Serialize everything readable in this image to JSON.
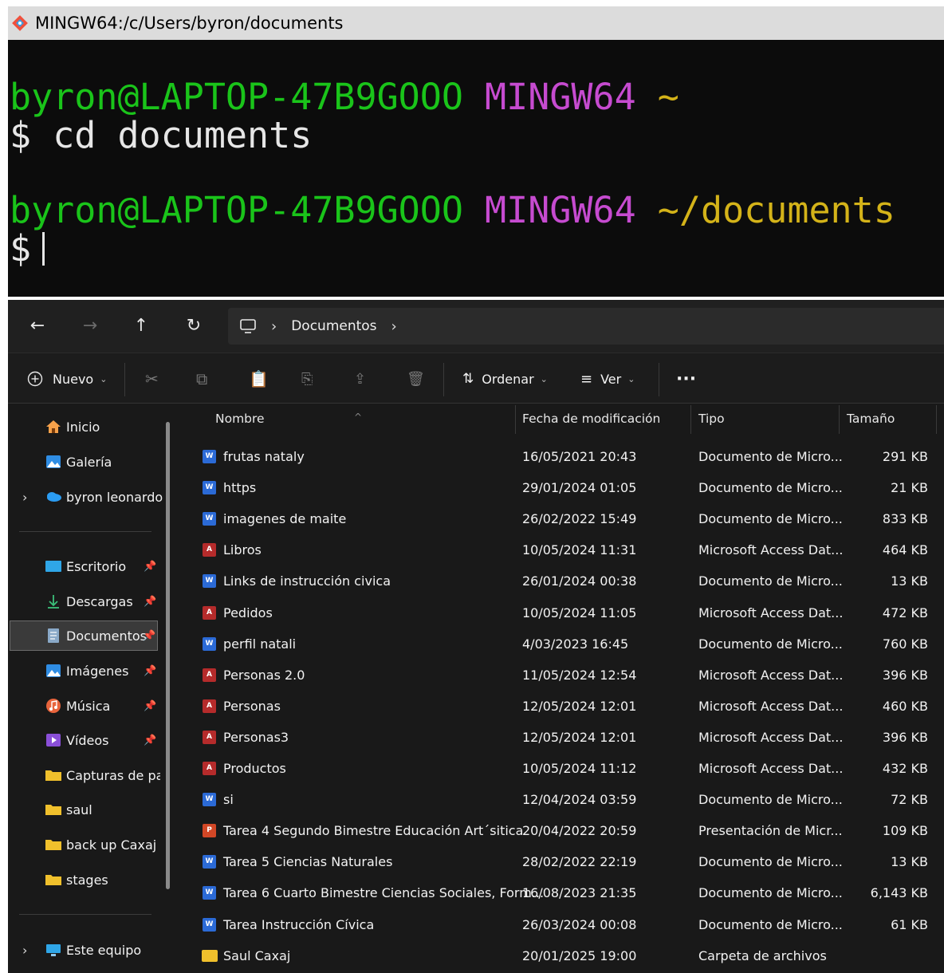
{
  "terminal": {
    "title": "MINGW64:/c/Users/byron/documents",
    "lines": [
      {
        "user": "byron@LAPTOP-47B9GOOO",
        "env": "MINGW64",
        "path": "~"
      },
      {
        "prompt": "$",
        "command": "cd documents"
      },
      {
        "user": "byron@LAPTOP-47B9GOOO",
        "env": "MINGW64",
        "path": "~/documents"
      },
      {
        "prompt": "$",
        "command": ""
      }
    ]
  },
  "explorer": {
    "breadcrumb": {
      "location": "Documentos"
    },
    "toolbar": {
      "new_label": "Nuevo",
      "sort_label": "Ordenar",
      "view_label": "Ver",
      "more_label": "···"
    },
    "sidebar": {
      "items": [
        {
          "label": "Inicio",
          "icon": "home-icon"
        },
        {
          "label": "Galería",
          "icon": "gallery-icon"
        },
        {
          "label": "byron leonardo",
          "icon": "onedrive-icon"
        },
        {
          "label": "Escritorio",
          "icon": "desktop-icon"
        },
        {
          "label": "Descargas",
          "icon": "download-icon"
        },
        {
          "label": "Documentos",
          "icon": "documents-icon"
        },
        {
          "label": "Imágenes",
          "icon": "pictures-icon"
        },
        {
          "label": "Música",
          "icon": "music-icon"
        },
        {
          "label": "Vídeos",
          "icon": "videos-icon"
        },
        {
          "label": "Capturas de pantalla",
          "icon": "folder-icon"
        },
        {
          "label": "saul",
          "icon": "folder-icon"
        },
        {
          "label": "back up Caxaj",
          "icon": "folder-icon"
        },
        {
          "label": "stages",
          "icon": "folder-icon"
        },
        {
          "label": "Este equipo",
          "icon": "pc-icon"
        }
      ]
    },
    "columns": {
      "name": "Nombre",
      "date": "Fecha de modificación",
      "type": "Tipo",
      "size": "Tamaño"
    },
    "files": [
      {
        "name": "frutas nataly",
        "date": "16/05/2021 20:43",
        "type": "Documento de Micro...",
        "size": "291 KB",
        "kind": "word"
      },
      {
        "name": "https",
        "date": "29/01/2024 01:05",
        "type": "Documento de Micro...",
        "size": "21 KB",
        "kind": "word"
      },
      {
        "name": "imagenes de maite",
        "date": "26/02/2022 15:49",
        "type": "Documento de Micro...",
        "size": "833 KB",
        "kind": "word"
      },
      {
        "name": "Libros",
        "date": "10/05/2024 11:31",
        "type": "Microsoft Access Dat...",
        "size": "464 KB",
        "kind": "access"
      },
      {
        "name": "Links de instrucción civica",
        "date": "26/01/2024 00:38",
        "type": "Documento de Micro...",
        "size": "13 KB",
        "kind": "word"
      },
      {
        "name": "Pedidos",
        "date": "10/05/2024 11:05",
        "type": "Microsoft Access Dat...",
        "size": "472 KB",
        "kind": "access"
      },
      {
        "name": "perfil natali",
        "date": "4/03/2023 16:45",
        "type": "Documento de Micro...",
        "size": "760 KB",
        "kind": "word"
      },
      {
        "name": "Personas 2.0",
        "date": "11/05/2024 12:54",
        "type": "Microsoft Access Dat...",
        "size": "396 KB",
        "kind": "access"
      },
      {
        "name": "Personas",
        "date": "12/05/2024 12:01",
        "type": "Microsoft Access Dat...",
        "size": "460 KB",
        "kind": "access"
      },
      {
        "name": "Personas3",
        "date": "12/05/2024 12:01",
        "type": "Microsoft Access Dat...",
        "size": "396 KB",
        "kind": "access"
      },
      {
        "name": "Productos",
        "date": "10/05/2024 11:12",
        "type": "Microsoft Access Dat...",
        "size": "432 KB",
        "kind": "access"
      },
      {
        "name": "si",
        "date": "12/04/2024 03:59",
        "type": "Documento de Micro...",
        "size": "72 KB",
        "kind": "word"
      },
      {
        "name": "Tarea 4 Segundo Bimestre Educación Art´sitica",
        "date": "20/04/2022 20:59",
        "type": "Presentación de Micr...",
        "size": "109 KB",
        "kind": "ppt"
      },
      {
        "name": "Tarea 5 Ciencias Naturales",
        "date": "28/02/2022 22:19",
        "type": "Documento de Micro...",
        "size": "13 KB",
        "kind": "word"
      },
      {
        "name": "Tarea 6 Cuarto Bimestre Ciencias Sociales, Form...",
        "date": "16/08/2023 21:35",
        "type": "Documento de Micro...",
        "size": "6,143 KB",
        "kind": "word"
      },
      {
        "name": "Tarea Instrucción Cívica",
        "date": "26/03/2024 00:08",
        "type": "Documento de Micro...",
        "size": "61 KB",
        "kind": "word"
      },
      {
        "name": "Saul Caxaj",
        "date": "20/01/2025 19:00",
        "type": "Carpeta de archivos",
        "size": "",
        "kind": "folder"
      }
    ]
  }
}
